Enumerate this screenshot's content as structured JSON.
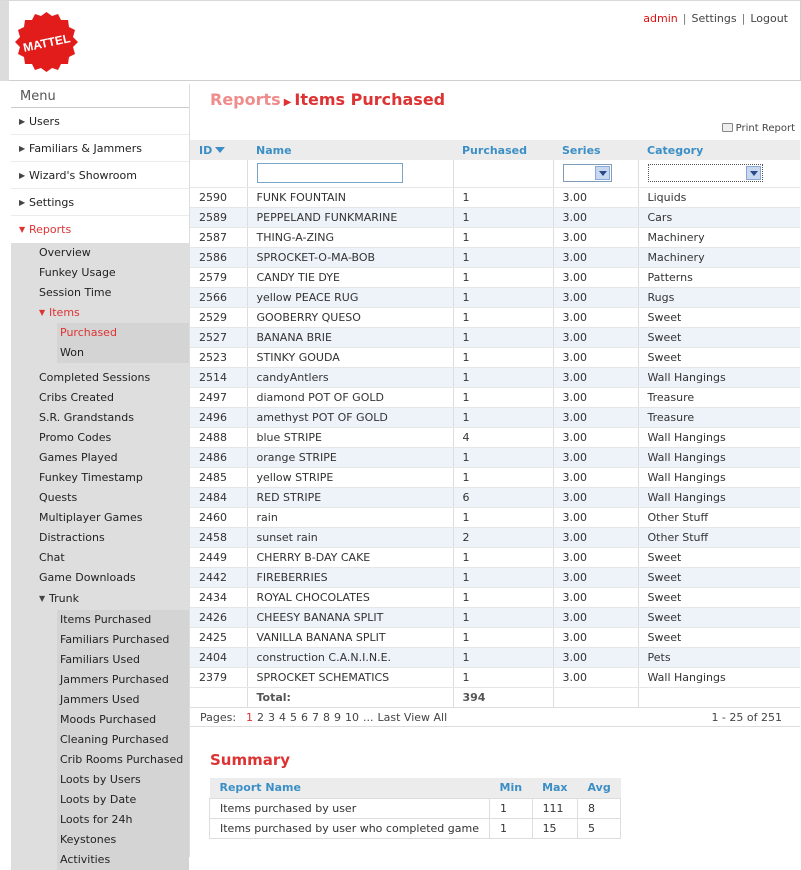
{
  "header": {
    "logo_text": "MATTEL",
    "user": "admin",
    "settings": "Settings",
    "logout": "Logout"
  },
  "sidebar": {
    "menu_title": "Menu",
    "top_items": [
      "Users",
      "Familiars & Jammers",
      "Wizard's Showroom",
      "Settings"
    ],
    "reports": {
      "label": "Reports",
      "before_items": [
        "Overview",
        "Funkey Usage",
        "Session Time"
      ],
      "items_group": {
        "label": "Items",
        "children": [
          "Purchased",
          "Won"
        ],
        "active": "Purchased"
      },
      "after_items": [
        "Completed Sessions",
        "Cribs Created",
        "S.R. Grandstands",
        "Promo Codes",
        "Games Played",
        "Funkey Timestamp",
        "Quests",
        "Multiplayer Games",
        "Distractions",
        "Chat",
        "Game Downloads"
      ],
      "trunk": {
        "label": "Trunk",
        "children": [
          "Items Purchased",
          "Familiars Purchased",
          "Familiars Used",
          "Jammers Purchased",
          "Jammers Used",
          "Moods Purchased",
          "Cleaning Purchased",
          "Crib Rooms Purchased",
          "Loots by Users",
          "Loots by Date",
          "Loots for 24h",
          "Keystones",
          "Activities"
        ]
      }
    }
  },
  "main": {
    "breadcrumb": {
      "parent": "Reports",
      "current": "Items Purchased"
    },
    "print": "Print Report",
    "columns": [
      "ID",
      "Name",
      "Purchased",
      "Series",
      "Category"
    ],
    "rows": [
      [
        "2590",
        "FUNK FOUNTAIN",
        "1",
        "3.00",
        "Liquids"
      ],
      [
        "2589",
        "PEPPELAND FUNKMARINE",
        "1",
        "3.00",
        "Cars"
      ],
      [
        "2587",
        "THING-A-ZING",
        "1",
        "3.00",
        "Machinery"
      ],
      [
        "2586",
        "SPROCKET-O-MA-BOB",
        "1",
        "3.00",
        "Machinery"
      ],
      [
        "2579",
        "CANDY TIE DYE",
        "1",
        "3.00",
        "Patterns"
      ],
      [
        "2566",
        "yellow PEACE RUG",
        "1",
        "3.00",
        "Rugs"
      ],
      [
        "2529",
        "GOOBERRY QUESO",
        "1",
        "3.00",
        "Sweet"
      ],
      [
        "2527",
        "BANANA BRIE",
        "1",
        "3.00",
        "Sweet"
      ],
      [
        "2523",
        "STINKY GOUDA",
        "1",
        "3.00",
        "Sweet"
      ],
      [
        "2514",
        "candyAntlers",
        "1",
        "3.00",
        "Wall Hangings"
      ],
      [
        "2497",
        "diamond POT OF GOLD",
        "1",
        "3.00",
        "Treasure"
      ],
      [
        "2496",
        "amethyst POT OF GOLD",
        "1",
        "3.00",
        "Treasure"
      ],
      [
        "2488",
        "blue STRIPE",
        "4",
        "3.00",
        "Wall Hangings"
      ],
      [
        "2486",
        "orange STRIPE",
        "1",
        "3.00",
        "Wall Hangings"
      ],
      [
        "2485",
        "yellow STRIPE",
        "1",
        "3.00",
        "Wall Hangings"
      ],
      [
        "2484",
        "RED STRIPE",
        "6",
        "3.00",
        "Wall Hangings"
      ],
      [
        "2460",
        "rain",
        "1",
        "3.00",
        "Other Stuff"
      ],
      [
        "2458",
        "sunset rain",
        "2",
        "3.00",
        "Other Stuff"
      ],
      [
        "2449",
        "CHERRY B-DAY CAKE",
        "1",
        "3.00",
        "Sweet"
      ],
      [
        "2442",
        "FIREBERRIES",
        "1",
        "3.00",
        "Sweet"
      ],
      [
        "2434",
        "ROYAL CHOCOLATES",
        "1",
        "3.00",
        "Sweet"
      ],
      [
        "2426",
        "CHEESY BANANA SPLIT",
        "1",
        "3.00",
        "Sweet"
      ],
      [
        "2425",
        "VANILLA BANANA SPLIT",
        "1",
        "3.00",
        "Sweet"
      ],
      [
        "2404",
        "construction C.A.N.I.N.E.",
        "1",
        "3.00",
        "Pets"
      ],
      [
        "2379",
        "SPROCKET SCHEMATICS",
        "1",
        "3.00",
        "Wall Hangings"
      ]
    ],
    "total_label": "Total:",
    "total_value": "394",
    "pager": {
      "label": "Pages:",
      "pages": [
        "1",
        "2",
        "3",
        "4",
        "5",
        "6",
        "7",
        "8",
        "9",
        "10",
        "...",
        "Last View All"
      ],
      "current": "1",
      "range": "1 - 25 of 251"
    },
    "summary": {
      "title": "Summary",
      "columns": [
        "Report Name",
        "Min",
        "Max",
        "Avg"
      ],
      "rows": [
        [
          "Items purchased by user",
          "1",
          "111",
          "8"
        ],
        [
          "Items purchased by user who completed game",
          "1",
          "15",
          "5"
        ]
      ]
    }
  },
  "colors": {
    "accent_red": "#dd3333",
    "header_blue": "#3b8fc6",
    "alt_row": "#eef3fa"
  }
}
